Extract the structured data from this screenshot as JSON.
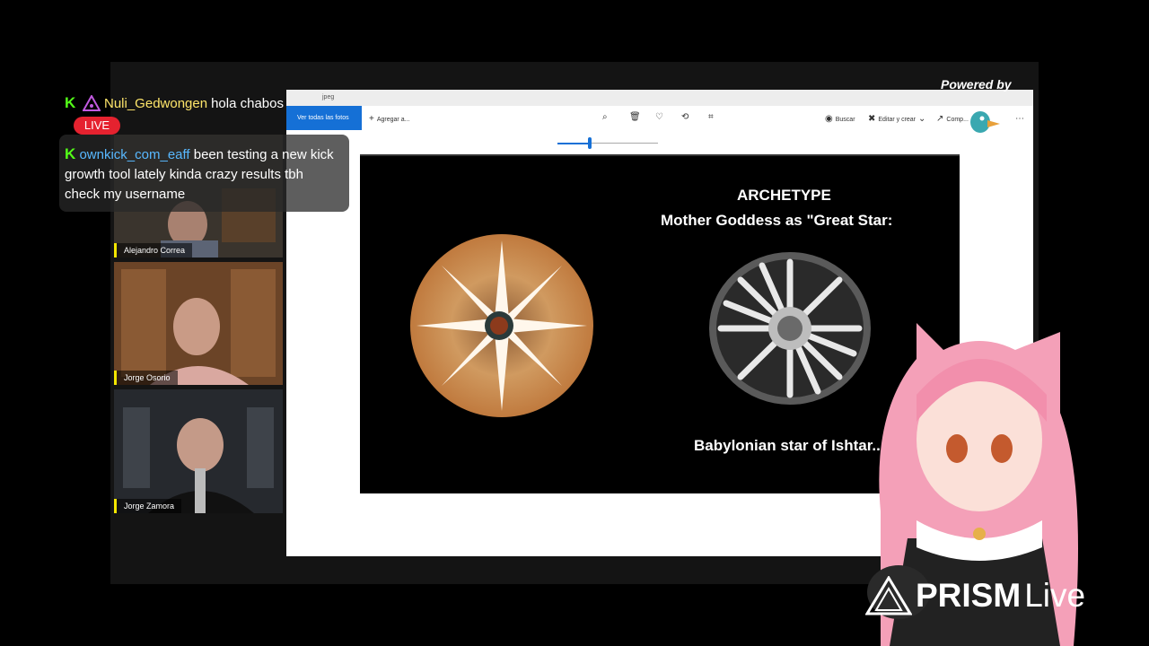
{
  "stage": {
    "powered_by": "Powered by",
    "streamyard": "StreamYard"
  },
  "photos": {
    "title": "jpeg",
    "toolbar": {
      "all_photos": "Ver todas las fotos",
      "add_to": "Agregar a...",
      "search": "Buscar",
      "edit_create": "Editar y crear",
      "share": "Comp..."
    },
    "zoom_value": 0.3
  },
  "slide": {
    "title": "ARCHETYPE",
    "subtitle": "Mother Goddess as \"Great Star:",
    "caption": "Babylonian star of Ishtar..."
  },
  "cams": [
    {
      "name": "Alejandro Correa"
    },
    {
      "name": "Jorge Osorio"
    },
    {
      "name": "Jorge Zamora"
    }
  ],
  "chat": {
    "msg1_user": "Nuli_Gedwongen",
    "msg1_text": "hola chabos",
    "live": "LIVE",
    "msg2_user": "ownkick_com_eaff",
    "msg2_text": "been testing a new kick growth tool lately kinda crazy results tbh check my username"
  },
  "overlay": {
    "prism_bold": "PRISM",
    "prism_light": "Live"
  },
  "colors": {
    "kick_green": "#53fc18",
    "live_red": "#e5222f",
    "windows_blue": "#1570d6",
    "label_yellow": "#f3e600"
  }
}
